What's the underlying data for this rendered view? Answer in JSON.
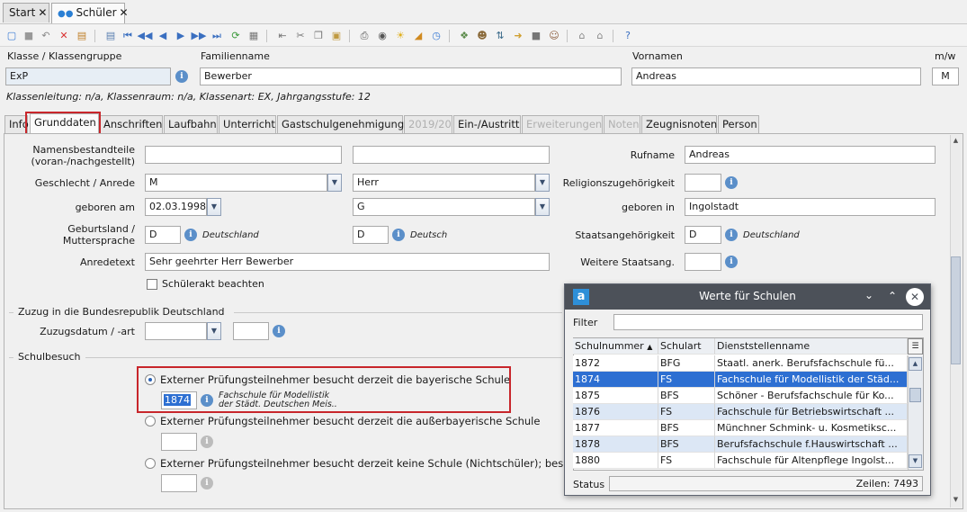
{
  "window_tabs": [
    {
      "label": "Start",
      "close": "✕"
    },
    {
      "label": "Schüler",
      "close": "✕"
    }
  ],
  "header": {
    "klasse_label": "Klasse / Klassengruppe",
    "klasse_value": "ExP",
    "familienname_label": "Familienname",
    "familienname_value": "Bewerber",
    "vornamen_label": "Vornamen",
    "vornamen_value": "Andreas",
    "mw_label": "m/w",
    "mw_value": "M",
    "info_line": "Klassenleitung: n/a, Klassenraum: n/a, Klassenart: EX, Jahrgangsstufe: 12"
  },
  "page_tabs": [
    {
      "label": "Info",
      "state": "normal"
    },
    {
      "label": "Grunddaten",
      "state": "active"
    },
    {
      "label": "Anschriften",
      "state": "normal"
    },
    {
      "label": "Laufbahn",
      "state": "normal"
    },
    {
      "label": "Unterricht",
      "state": "normal"
    },
    {
      "label": "Gastschulgenehmigung",
      "state": "normal"
    },
    {
      "label": "2019/20",
      "state": "disabled"
    },
    {
      "label": "Ein-/Austritt",
      "state": "normal"
    },
    {
      "label": "Erweiterungen",
      "state": "disabled"
    },
    {
      "label": "Noten",
      "state": "disabled"
    },
    {
      "label": "Zeugnisnoten",
      "state": "normal"
    },
    {
      "label": "Person",
      "state": "normal"
    }
  ],
  "form": {
    "namensbestandteile_label": "Namensbestandteile (voran-/nachgestellt)",
    "namensbestandteile_1": "",
    "namensbestandteile_2": "",
    "rufname_label": "Rufname",
    "rufname_value": "Andreas",
    "geschlecht_label": "Geschlecht / Anrede",
    "geschlecht_value": "M",
    "anrede_value": "Herr",
    "religion_label": "Religionszugehörigkeit",
    "religion_value": "",
    "geboren_am_label": "geboren am",
    "geboren_am_value": "02.03.1998",
    "geboren_g_value": "G",
    "geboren_in_label": "geboren in",
    "geboren_in_value": "Ingolstadt",
    "geburtsland_label": "Geburtsland / Muttersprache",
    "geburtsland_value": "D",
    "geburtsland_text": "Deutschland",
    "muttersprache_value": "D",
    "muttersprache_text": "Deutsch",
    "staatsang_label": "Staatsangehörigkeit",
    "staatsang_value": "D",
    "staatsang_text": "Deutschland",
    "anredetext_label": "Anredetext",
    "anredetext_value": "Sehr geehrter Herr Bewerber",
    "weitere_label": "Weitere Staatsang.",
    "weitere_value": "",
    "schuelerakt_label": "Schülerakt beachten",
    "zuzug_section": "Zuzug in die Bundesrepublik Deutschland",
    "zuzugsdatum_label": "Zuzugsdatum / -art",
    "zuzugsdatum_value": "",
    "zuzugsart_value": "",
    "schulbesuch_section": "Schulbesuch",
    "radio1_label": "Externer Prüfungsteilnehmer besucht derzeit die bayerische Schule",
    "radio1_value": "1874",
    "radio1_desc": "Fachschule für Modellistik der Städt. Deutschen Meis..",
    "radio2_label": "Externer Prüfungsteilnehmer besucht derzeit die außerbayerische Schule",
    "radio3_label": "Externer Prüfungsteilnehmer besucht derzeit keine Schule (Nichtschüler); besuc"
  },
  "dialog": {
    "title": "Werte für Schulen",
    "filter_label": "Filter",
    "filter_value": "",
    "columns": [
      "Schulnummer",
      "Schulart",
      "Dienststellenname"
    ],
    "rows": [
      {
        "nr": "1872",
        "art": "BFG",
        "name": "Staatl. anerk. Berufsfachschule fü..."
      },
      {
        "nr": "1874",
        "art": "FS",
        "name": "Fachschule für Modellistik der Städ..."
      },
      {
        "nr": "1875",
        "art": "BFS",
        "name": "Schöner - Berufsfachschule für Ko..."
      },
      {
        "nr": "1876",
        "art": "FS",
        "name": "Fachschule für Betriebswirtschaft ..."
      },
      {
        "nr": "1877",
        "art": "BFS",
        "name": "Münchner Schmink- u. Kosmetiksc..."
      },
      {
        "nr": "1878",
        "art": "BFS",
        "name": "Berufsfachschule f.Hauswirtschaft ..."
      },
      {
        "nr": "1880",
        "art": "FS",
        "name": "Fachschule für Altenpflege Ingolst..."
      }
    ],
    "status_label": "Status",
    "status_value": "Zeilen: 7493"
  },
  "colors": {
    "accent": "#2d6fd2",
    "highlight": "#c8262b",
    "titlebar": "#4c5159"
  }
}
